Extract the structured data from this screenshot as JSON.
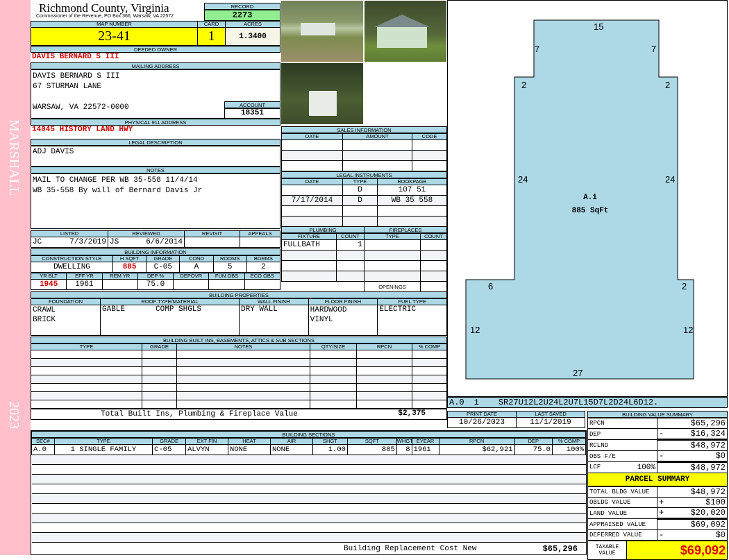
{
  "sidebar": {
    "name": "MARSHALL",
    "year": "2023"
  },
  "header": {
    "county": "Richmond County, Virginia",
    "subtitle": "Commissioner of the Revenue, PO Box 366, Warsaw, VA 22572",
    "record_label": "RECORD",
    "record": "2273"
  },
  "parcel": {
    "map_label": "MAP NUMBER",
    "map": "23-41",
    "card_label": "CARD",
    "card": "1",
    "acres_label": "ACRES",
    "acres": "1.3400"
  },
  "owner": {
    "label": "DEEDED OWNER",
    "value": "DAVIS BERNARD S III"
  },
  "mailing": {
    "label": "MAILING ADDRESS",
    "line1": "DAVIS BERNARD S III",
    "line2": "67 STURMAN LANE",
    "line3": "WARSAW, VA 22572-0000",
    "account_label": "ACCOUNT",
    "account": "18351"
  },
  "physical": {
    "label": "PHYSICAL 911 ADDRESS",
    "value": "14045 HISTORY LAND HWY"
  },
  "legal": {
    "label": "LEGAL DESCRIPTION",
    "value": "ADJ DAVIS"
  },
  "notes": {
    "label": "NOTES",
    "line1": "MAIL TO CHANGE PER WB 35-558 11/4/14",
    "line2": "WB 35-558 By will of Bernard Davis Jr"
  },
  "review": {
    "listed_label": "LISTED",
    "reviewed_label": "REVIEWED",
    "revisit_label": "REVISIT",
    "appeals_label": "APPEALS",
    "listed_by": "JC",
    "listed_date": "7/3/2019",
    "reviewed_by": "JS",
    "reviewed_date": "6/6/2014"
  },
  "bldg_info": {
    "label": "BUILDING INFORMATION",
    "h": [
      "CONSTRUCTION STYLE",
      "H SQFT",
      "GRADE",
      "COND",
      "ROOMS",
      "BDRMS"
    ],
    "v": [
      "DWELLING",
      "885",
      "C-05",
      "A",
      "5",
      "2"
    ],
    "h2": [
      "YR BLT",
      "EFF YR",
      "REM YR",
      "DEP %",
      "DEPOVR",
      "FUN OBS",
      "ECO OBS"
    ],
    "v2": [
      "1945",
      "1961",
      "",
      "75.0",
      "",
      "",
      ""
    ]
  },
  "bldg_props": {
    "label": "BUILDING PROPERTIES",
    "h": [
      "FOUNDATION",
      "ROOF TYPE/MATERIAL",
      "WALL FINISH",
      "FLOOR FINISH",
      "FUEL TYPE"
    ],
    "foundation1": "CRAWL",
    "foundation2": "BRICK",
    "roof1": "GABLE",
    "roof2": "COMP SHGLS",
    "wall": "DRY WALL",
    "floor1": "HARDWOOD",
    "floor2": "VINYL",
    "fuel": "ELECTRIC"
  },
  "builtins": {
    "label": "BUILDING BUILT INS, BASEMENTS, ATTICS & SUB SECTIONS",
    "h": [
      "TYPE",
      "GRADE",
      "NOTES",
      "QTY/SIZE",
      "RPCN",
      "% COMP"
    ],
    "total_label": "Total Built Ins, Plumbing & Fireplace Value",
    "total": "$2,375"
  },
  "sections": {
    "label": "BUILDING SECTIONS",
    "h": [
      "SEC#",
      "TYPE",
      "GRADE",
      "EXT FIN",
      "HEAT",
      "AIR",
      "SHGT",
      "SQFT",
      "WHGT",
      "EYEAR",
      "RPCN",
      "DEP",
      "% COMP"
    ],
    "row": [
      "A.0",
      "1 SINGLE FAMILY",
      "C-05",
      "ALVYN",
      "NONE",
      "NONE",
      "1.00",
      "885",
      "8",
      "1961",
      "$62,921",
      "75.0",
      "100%"
    ],
    "cost_label": "Building Replacement Cost New",
    "cost": "$65,296"
  },
  "sales": {
    "label": "SALES INFORMATION",
    "h": [
      "DATE",
      "AMOUNT",
      "CODE"
    ]
  },
  "instruments": {
    "label": "LEGAL INSTRUMENTS",
    "h": [
      "DATE",
      "TYPE",
      "BOOKPAGE"
    ],
    "rows": [
      [
        "",
        "D",
        "107 51"
      ],
      [
        "7/17/2014",
        "D",
        "WB 35 558"
      ]
    ]
  },
  "plumbing": {
    "label": "PLUMBING",
    "h": [
      "FIXTURE",
      "COUNT"
    ],
    "fixture": "FULLBATH",
    "count": "1"
  },
  "fireplaces": {
    "label": "FIREPLACES",
    "h": [
      "TYPE",
      "COUNT"
    ],
    "openings": "OPENINGS"
  },
  "sketch": {
    "area_label": "A.1",
    "area": "885 SqFt",
    "dims": [
      "15",
      "7",
      "7",
      "2",
      "2",
      "24",
      "24",
      "6",
      "2",
      "12",
      "12",
      "27"
    ],
    "code_sec": "A.0",
    "code_num": "1",
    "code": "SR27U12L2U24L2U7L15D7L2D24L6D12.",
    "fill": "#add8e6"
  },
  "dates": {
    "print_label": "PRINT DATE",
    "print": "10/26/2023",
    "saved_label": "LAST SAVED",
    "saved": "11/1/2019"
  },
  "value_summary": {
    "label": "BUILDING VALUE SUMMARY",
    "rpcn_l": "RPCN",
    "rpcn": "$65,296",
    "dep_l": "DEP",
    "dep": "$16,324",
    "rclnd_l": "RCLND",
    "rclnd": "$48,972",
    "obs_l": "OBS F/E",
    "obs": "$0",
    "lcf_l": "LCF",
    "lcf_pct": "100%",
    "lcf": "$48,972",
    "minus": "-"
  },
  "parcel_summary": {
    "label": "PARCEL SUMMARY",
    "total_l": "TOTAL BLDG VALUE",
    "total": "$48,972",
    "obldg_l": "OBLDG VALUE",
    "obldg": "$100",
    "land_l": "LAND VALUE",
    "land": "$20,020",
    "appr_l": "APPRAISED VALUE",
    "appr": "$69,092",
    "def_l": "DEFERRED VALUE",
    "def": "$0",
    "taxable_l1": "TAXABLE",
    "taxable_l2": "VALUE",
    "taxable": "$69,092",
    "plus": "+",
    "minus": "-"
  }
}
